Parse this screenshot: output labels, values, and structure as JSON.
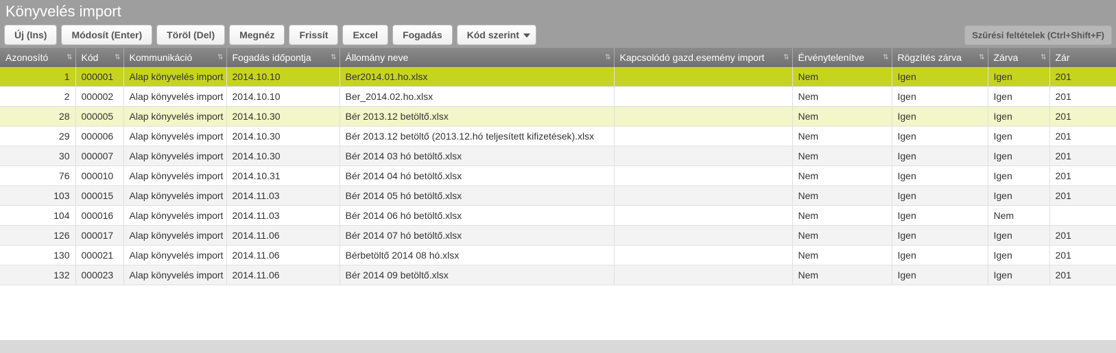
{
  "title": "Könyvelés import",
  "toolbar": {
    "new": "Új (Ins)",
    "modify": "Módosít (Enter)",
    "delete": "Töröl (Del)",
    "view": "Megnéz",
    "refresh": "Frissít",
    "excel": "Excel",
    "receive": "Fogadás",
    "sort": "Kód szerint",
    "filter": "Szűrési feltételek (Ctrl+Shift+F)"
  },
  "columns": {
    "id": "Azonosító",
    "kod": "Kód",
    "komm": "Kommunikáció",
    "fogadas": "Fogadás időpontja",
    "allomany": "Állomány neve",
    "kapcs": "Kapcsolódó gazd.esemény import",
    "ervtelen": "Érvénytelenítve",
    "rogzzar": "Rögzítés zárva",
    "zarva": "Zárva",
    "zar2": "Zár"
  },
  "rows": [
    {
      "id": "1",
      "kod": "000001",
      "komm": "Alap könyvelés import",
      "fog": "2014.10.10",
      "all": "Ber2014.01.ho.xlsx",
      "kap": "",
      "erv": "Nem",
      "rog": "Igen",
      "zar": "Igen",
      "z2": "201",
      "style": "sel"
    },
    {
      "id": "2",
      "kod": "000002",
      "komm": "Alap könyvelés import",
      "fog": "2014.10.10",
      "all": "Ber_2014.02.ho.xlsx",
      "kap": "",
      "erv": "Nem",
      "rog": "Igen",
      "zar": "Igen",
      "z2": "201",
      "style": "plain"
    },
    {
      "id": "28",
      "kod": "000005",
      "komm": "Alap könyvelés import",
      "fog": "2014.10.30",
      "all": "Bér 2013.12 betöltő.xlsx",
      "kap": "",
      "erv": "Nem",
      "rog": "Igen",
      "zar": "Igen",
      "z2": "201",
      "style": "hl"
    },
    {
      "id": "29",
      "kod": "000006",
      "komm": "Alap könyvelés import",
      "fog": "2014.10.30",
      "all": "Bér 2013.12 betöltő (2013.12.hó teljesített kifizetések).xlsx",
      "kap": "",
      "erv": "Nem",
      "rog": "Igen",
      "zar": "Igen",
      "z2": "201",
      "style": "plain"
    },
    {
      "id": "30",
      "kod": "000007",
      "komm": "Alap könyvelés import",
      "fog": "2014.10.30",
      "all": "Bér 2014 03 hó betöltő.xlsx",
      "kap": "",
      "erv": "Nem",
      "rog": "Igen",
      "zar": "Igen",
      "z2": "201",
      "style": "alt"
    },
    {
      "id": "76",
      "kod": "000010",
      "komm": "Alap könyvelés import",
      "fog": "2014.10.31",
      "all": "Bér 2014 04 hó betöltő.xlsx",
      "kap": "",
      "erv": "Nem",
      "rog": "Igen",
      "zar": "Igen",
      "z2": "201",
      "style": "plain"
    },
    {
      "id": "103",
      "kod": "000015",
      "komm": "Alap könyvelés import",
      "fog": "2014.11.03",
      "all": "Bér 2014 05 hó betöltő.xlsx",
      "kap": "",
      "erv": "Nem",
      "rog": "Igen",
      "zar": "Igen",
      "z2": "201",
      "style": "alt"
    },
    {
      "id": "104",
      "kod": "000016",
      "komm": "Alap könyvelés import",
      "fog": "2014.11.03",
      "all": "Bér 2014 06 hó betöltő.xlsx",
      "kap": "",
      "erv": "Nem",
      "rog": "Igen",
      "zar": "Nem",
      "z2": "",
      "style": "plain"
    },
    {
      "id": "126",
      "kod": "000017",
      "komm": "Alap könyvelés import",
      "fog": "2014.11.06",
      "all": "Bér 2014 07 hó betöltő.xlsx",
      "kap": "",
      "erv": "Nem",
      "rog": "Igen",
      "zar": "Igen",
      "z2": "201",
      "style": "alt"
    },
    {
      "id": "130",
      "kod": "000021",
      "komm": "Alap könyvelés import",
      "fog": "2014.11.06",
      "all": "Bérbetöltő 2014 08 hó.xlsx",
      "kap": "",
      "erv": "Nem",
      "rog": "Igen",
      "zar": "Igen",
      "z2": "201",
      "style": "plain"
    },
    {
      "id": "132",
      "kod": "000023",
      "komm": "Alap könyvelés import",
      "fog": "2014.11.06",
      "all": "Bér 2014 09 betöltő.xlsx",
      "kap": "",
      "erv": "Nem",
      "rog": "Igen",
      "zar": "Igen",
      "z2": "201",
      "style": "alt"
    }
  ]
}
